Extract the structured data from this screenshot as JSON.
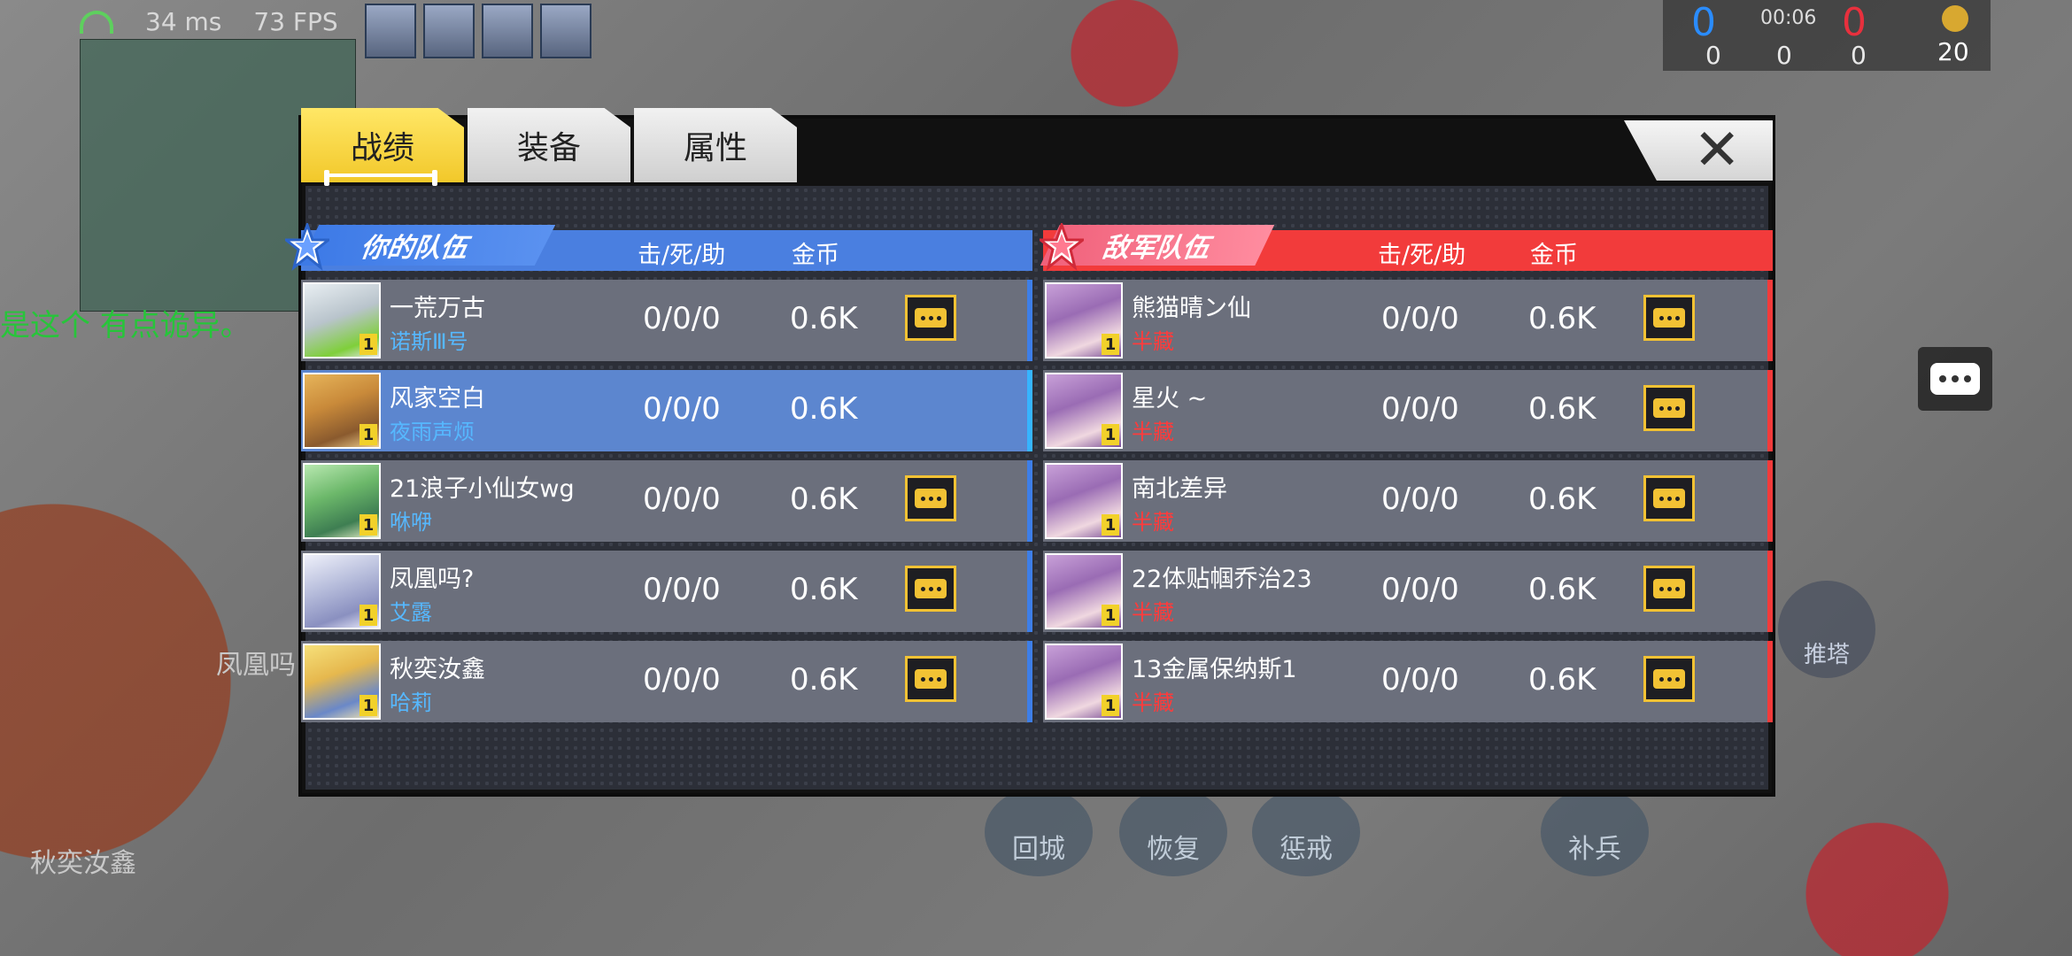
{
  "hud": {
    "ping": "34 ms",
    "fps": "73 FPS",
    "score_blue": "0",
    "score_red": "0",
    "timer": "00:06",
    "stat_a": "0",
    "stat_b": "0",
    "stat_c": "0",
    "gold": "20",
    "chat_line": "是这个   有点诡异。",
    "name_phoenix": "凤凰吗",
    "name_qiu": "秋奕汝鑫",
    "tower_label": "推塔",
    "skills": [
      "回城",
      "恢复",
      "惩戒",
      "补兵"
    ]
  },
  "tabs": [
    {
      "label": "战绩",
      "active": true
    },
    {
      "label": "装备",
      "active": false
    },
    {
      "label": "属性",
      "active": false
    }
  ],
  "close_label": "✕",
  "ally": {
    "title": "你的队伍",
    "col_kda": "击/死/助",
    "col_gold": "金币",
    "color": "#4a7fe0",
    "players": [
      {
        "name": "一荒万古",
        "hero": "诺斯Ⅲ号",
        "level": "1",
        "kda": "0/0/0",
        "gold": "0.6K",
        "self": false
      },
      {
        "name": "风家空白",
        "hero": "夜雨声烦",
        "level": "1",
        "kda": "0/0/0",
        "gold": "0.6K",
        "self": true
      },
      {
        "name": "21浪子小仙女wg",
        "hero": "咻咿",
        "level": "1",
        "kda": "0/0/0",
        "gold": "0.6K",
        "self": false
      },
      {
        "name": "凤凰吗?",
        "hero": "艾露",
        "level": "1",
        "kda": "0/0/0",
        "gold": "0.6K",
        "self": false
      },
      {
        "name": "秋奕汝鑫",
        "hero": "哈莉",
        "level": "1",
        "kda": "0/0/0",
        "gold": "0.6K",
        "self": false
      }
    ]
  },
  "enemy": {
    "title": "敌军队伍",
    "col_kda": "击/死/助",
    "col_gold": "金币",
    "color": "#f23b3b",
    "players": [
      {
        "name": "熊猫晴ン仙",
        "hero": "半藏",
        "level": "1",
        "kda": "0/0/0",
        "gold": "0.6K"
      },
      {
        "name": "星火 ~",
        "hero": "半藏",
        "level": "1",
        "kda": "0/0/0",
        "gold": "0.6K"
      },
      {
        "name": "南北差异",
        "hero": "半藏",
        "level": "1",
        "kda": "0/0/0",
        "gold": "0.6K"
      },
      {
        "name": "22体贴帼乔治23",
        "hero": "半藏",
        "level": "1",
        "kda": "0/0/0",
        "gold": "0.6K"
      },
      {
        "name": "13金属保纳斯1",
        "hero": "半藏",
        "level": "1",
        "kda": "0/0/0",
        "gold": "0.6K"
      }
    ]
  }
}
